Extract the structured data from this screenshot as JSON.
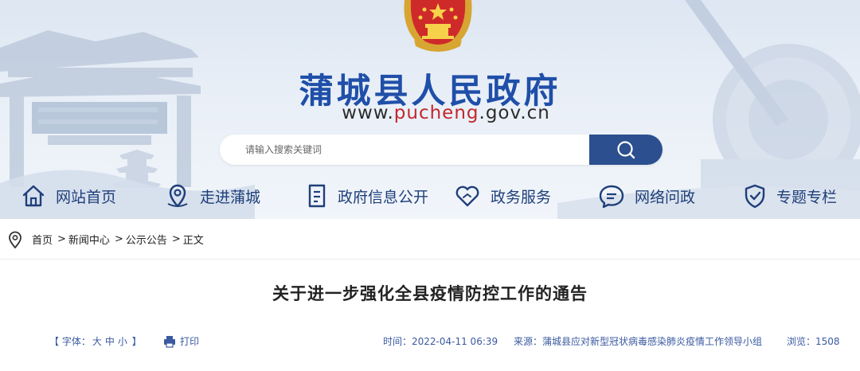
{
  "header": {
    "site_name": "蒲城县人民政府",
    "url_prefix": "www.",
    "url_accent": "pucheng",
    "url_suffix": ".gov.cn",
    "emblem": "national-emblem-icon"
  },
  "search": {
    "placeholder": "请输入搜索关键词",
    "button_icon": "search-icon"
  },
  "nav": {
    "items": [
      {
        "label": "网站首页",
        "icon": "home-icon"
      },
      {
        "label": "走进蒲城",
        "icon": "location-icon"
      },
      {
        "label": "政府信息公开",
        "icon": "document-icon"
      },
      {
        "label": "政务服务",
        "icon": "heart-icon"
      },
      {
        "label": "网络问政",
        "icon": "chat-icon"
      },
      {
        "label": "专题专栏",
        "icon": "shield-check-icon"
      }
    ]
  },
  "breadcrumb": {
    "icon": "map-pin-icon",
    "items": [
      "首页",
      "新闻中心",
      "公示公告",
      "正文"
    ],
    "separator": ">"
  },
  "article": {
    "title": "关于进一步强化全县疫情防控工作的通告",
    "font_prefix": "【 字体：",
    "font_large": "大",
    "font_medium": "中",
    "font_small": "小",
    "font_suffix": " 】",
    "print_label": "打印",
    "time_label": "时间：2022-04-11 06:39",
    "source_label": "来源：蒲城县应对新型冠状病毒感染肺炎疫情工作领导小组",
    "views_label": "浏览：1508"
  },
  "colors": {
    "brand_blue": "#1f4fa8",
    "nav_blue": "#1f3f7a",
    "search_button": "#2b4f8f",
    "url_accent": "#c2272d"
  }
}
